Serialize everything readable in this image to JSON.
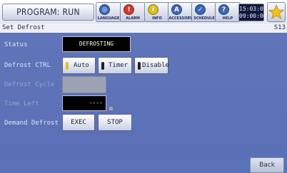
{
  "header": {
    "program_label": "PROGRAM: RUN",
    "nav": [
      {
        "label": "LANGUAGE",
        "icon": "globe-icon",
        "color": "#3a66b8",
        "glyph": "◎"
      },
      {
        "label": "ALARM",
        "icon": "alarm-icon",
        "color": "#d23a2c",
        "glyph": "!"
      },
      {
        "label": "INFO",
        "icon": "info-icon",
        "color": "#d9c21a",
        "glyph": "i"
      },
      {
        "label": "ACCESSORY",
        "icon": "accessory-icon",
        "color": "#3a66b8",
        "glyph": "A"
      },
      {
        "label": "SCHEDULE",
        "icon": "schedule-icon",
        "color": "#3a66b8",
        "glyph": "✓"
      },
      {
        "label": "HELP",
        "icon": "help-icon",
        "color": "#3a66b8",
        "glyph": "?"
      }
    ],
    "time": "15:03:05",
    "date": "09:00:00",
    "star_icon": "star-icon"
  },
  "title": {
    "text": "Set Defrost",
    "code": "S13"
  },
  "rows": {
    "status_label": "Status",
    "status_value": "DEFROSTING",
    "defrost_ctrl_label": "Defrost CTRL",
    "mode_buttons": [
      {
        "label": "Auto",
        "led": "#e2c21c"
      },
      {
        "label": "Timer",
        "led": "#222222"
      },
      {
        "label": "Disable",
        "led": "#222222"
      }
    ],
    "defrost_cycle_label": "Defrost Cycle",
    "time_left_label": "Time Left",
    "time_left_value": "----",
    "demand_label": "Demand Defrost",
    "exec_label": "EXEC",
    "stop_label": "STOP"
  },
  "footer": {
    "back_label": "Back"
  }
}
